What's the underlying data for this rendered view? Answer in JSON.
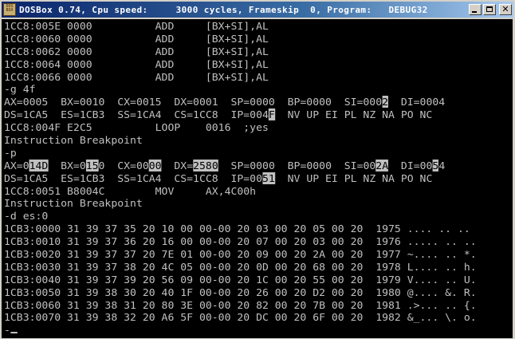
{
  "window": {
    "title": "DOSBox 0.74, Cpu speed:     3000 cycles, Frameskip  0, Program:   DEBUG32",
    "icon_text": "DOS BOX",
    "buttons": {
      "minimize": "minimize-icon",
      "maximize": "maximize-icon",
      "close": "close-icon"
    }
  },
  "colors": {
    "console_bg": "#000000",
    "console_fg": "#c0c0c0",
    "highlight_bg": "#c0c0c0",
    "highlight_fg": "#000000"
  },
  "console": {
    "lines": [
      [
        "1CC8:005E 0000          ADD     [BX+SI],AL"
      ],
      [
        "1CC8:0060 0000          ADD     [BX+SI],AL"
      ],
      [
        "1CC8:0062 0000          ADD     [BX+SI],AL"
      ],
      [
        "1CC8:0064 0000          ADD     [BX+SI],AL"
      ],
      [
        "1CC8:0066 0000          ADD     [BX+SI],AL"
      ],
      [
        "-g 4f"
      ],
      [
        "AX=0005  BX=0010  CX=0015  DX=0001  SP=0000  BP=0000  SI=000",
        {
          "hl": "2"
        },
        "  DI=0004"
      ],
      [
        "DS=1CA5  ES=1CB3  SS=1CA4  CS=1CC8  IP=004",
        {
          "hl": "F"
        },
        "  NV UP EI PL NZ NA PO NC"
      ],
      [
        "1CC8:004F E2C5          LOOP    0016  ;yes"
      ],
      [
        "Instruction Breakpoint"
      ],
      [
        "-p"
      ],
      [
        "AX=0",
        {
          "hl": "14D"
        },
        "  BX=0",
        {
          "hl": "15"
        },
        "0  CX=00",
        {
          "hl": "00"
        },
        "  DX=",
        {
          "hl": "2580"
        },
        "  SP=0000  BP=0000  SI=00",
        {
          "hl": "2A"
        },
        "  DI=00",
        {
          "hl": "5"
        },
        "4"
      ],
      [
        "DS=1CA5  ES=1CB3  SS=1CA4  CS=1CC8  IP=00",
        {
          "hl": "51"
        },
        "  NV UP EI PL NZ NA PO NC"
      ],
      [
        "1CC8:0051 B8004C        MOV     AX,4C00h"
      ],
      [
        "Instruction Breakpoint"
      ],
      [
        "-d es:0"
      ],
      [
        "1CB3:0000 31 39 37 35 20 10 00 00-00 20 03 00 20 05 00 20  1975 .... .. .."
      ],
      [
        "1CB3:0010 31 39 37 36 20 16 00 00-00 20 07 00 20 03 00 20  1976 ..... .. .."
      ],
      [
        "1CB3:0020 31 39 37 37 20 7E 01 00-00 20 09 00 20 2A 00 20  1977 ~.... .. *."
      ],
      [
        "1CB3:0030 31 39 37 38 20 4C 05 00-00 20 0D 00 20 68 00 20  1978 L.... .. h."
      ],
      [
        "1CB3:0040 31 39 37 39 20 56 09 00-00 20 1C 00 20 55 00 20  1979 V.... .. U."
      ],
      [
        "1CB3:0050 31 39 38 30 20 40 1F 00-00 20 26 00 20 D2 00 20  1980 @.... &. R."
      ],
      [
        "1CB3:0060 31 39 38 31 20 80 3E 00-00 20 82 00 20 7B 00 20  1981 .>... .. {."
      ],
      [
        "1CB3:0070 31 39 38 32 20 A6 5F 00-00 20 DC 00 20 6F 00 20  1982 &_... \\. o."
      ],
      [
        {
          "cursor": "-"
        }
      ]
    ]
  }
}
